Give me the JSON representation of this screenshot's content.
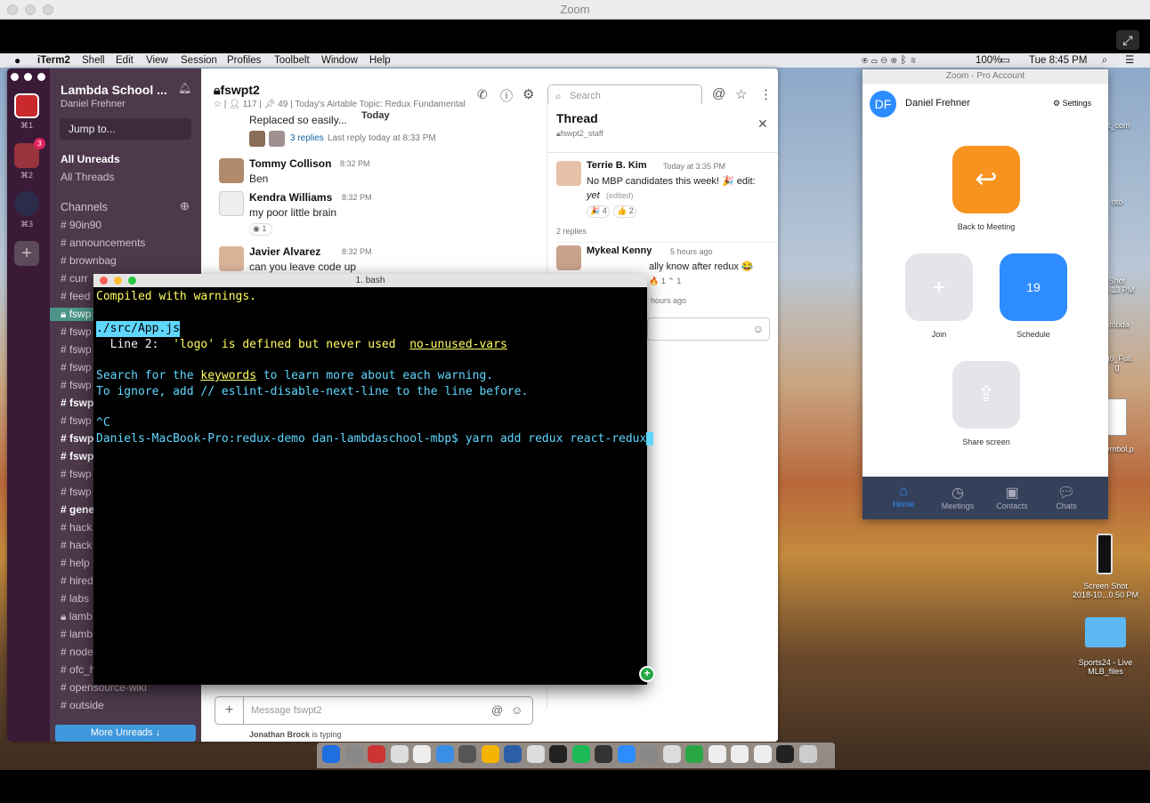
{
  "zoom_window": {
    "title": "Zoom"
  },
  "menubar": {
    "app": "iTerm2",
    "items": [
      "Shell",
      "Edit",
      "View",
      "Session",
      "Profiles",
      "Toolbelt",
      "Window",
      "Help"
    ],
    "battery": "100%",
    "clock": "Tue 8:45 PM"
  },
  "slack": {
    "ws_keys": [
      "⌘1",
      "⌘2",
      "⌘3"
    ],
    "ws_badge": "3",
    "workspace": "Lambda School ...",
    "user": "Daniel Frehner",
    "jump": "Jump to...",
    "all_unreads": "All Unreads",
    "all_threads": "All Threads",
    "channels_header": "Channels",
    "channels": [
      "90in90",
      "announcements",
      "brownbag",
      "curr",
      "feed",
      "fswp",
      "fswp",
      "fswp",
      "fswp",
      "fswp",
      "fswp",
      "fswp",
      "fswp",
      "fswp",
      "fswp",
      "fswp",
      "gene",
      "hack",
      "hack",
      "help",
      "hired",
      "labs",
      "lamb",
      "lamb",
      "node",
      "ofc_hrs_dan_wed_eve",
      "opensource-wiki",
      "outside"
    ],
    "more_unreads": "More Unreads",
    "channel_name": "fswpt2",
    "members": "117",
    "pins": "49",
    "topic": "Today's Airtable Topic: Redux Fundamental",
    "search_placeholder": "Search",
    "date_divider": "Today",
    "msg0_text": "Replaced so easily...",
    "msg0_replies": "3 replies",
    "msg0_last": "Last reply today at 8:33 PM",
    "messages": [
      {
        "name": "Tommy Collison",
        "time": "8:32 PM",
        "text": "Ben"
      },
      {
        "name": "Kendra Williams",
        "time": "8:32 PM",
        "text": "my poor little brain",
        "reaction": "1"
      },
      {
        "name": "Javier Alvarez",
        "time": "8:32 PM",
        "text": "can you leave code up"
      }
    ],
    "composer_placeholder": "Message fswpt2",
    "typing_name": "Jonathan Brock",
    "typing_text": "is typing",
    "thread": {
      "title": "Thread",
      "channel": "fswpt2_staff",
      "author": "Terrie B. Kim",
      "time": "Today at 3:35 PM",
      "text": "No MBP candidates this week! 🎉 edit:",
      "text2": "yet",
      "edited": "(edited)",
      "r1": "4",
      "r2": "2",
      "replies": "2 replies",
      "reply_author": "Mykeal Kenny",
      "reply_time": "5 hours ago",
      "reply_text": "ally know after redux 😂",
      "reply_r1": "1",
      "reply_r2": "1",
      "ago": "hours ago"
    }
  },
  "terminal": {
    "title": "1. bash",
    "l1": "Compiled with warnings.",
    "l2_file": "./src/App.js",
    "l3_pre": "  Line 2:  ",
    "l3_msg": "'logo' is defined but never used  ",
    "l3_rule": "no-unused-vars",
    "l4_pre": "Search for the ",
    "l4_kw": "keywords",
    "l4_post": " to learn more about each warning.",
    "l5_pre": "To ignore, add ",
    "l5_kw": "// eslint-disable-next-line",
    "l5_post": " to the line before.",
    "l6": "^C",
    "prompt": "Daniels-MacBook-Pro:redux-demo dan-lambdaschool-mbp$ ",
    "cmd": "yarn add redux react-redux"
  },
  "zoom_app": {
    "title": "Zoom - Pro Account",
    "initials": "DF",
    "user": "Daniel Frehner",
    "settings": "Settings",
    "back": "Back to Meeting",
    "join": "Join",
    "schedule": "Schedule",
    "schedule_day": "19",
    "share": "Share screen",
    "tabs": [
      "Home",
      "Meetings",
      "Contacts",
      "Chats"
    ]
  },
  "desktop": {
    "items": [
      "ct_com",
      "oto",
      "Shot",
      "05.13 PM",
      "ambda",
      "ogo_Full.",
      "g",
      "Symbol.p",
      "Screen Shot",
      "2018-10...0.50 PM",
      "Sports24 - Live",
      "MLB_files"
    ]
  },
  "colors": {
    "slack_sidebar": "#4d394b",
    "zoom_blue": "#2d8cff",
    "zoom_orange": "#f7931e",
    "term_cyan": "#5fd7ff",
    "term_yellow": "#ffff5f"
  }
}
